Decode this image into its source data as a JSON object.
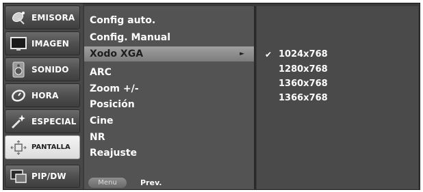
{
  "sidebar": {
    "items": [
      {
        "label": "EMISORA",
        "icon": "satellite-dish-icon"
      },
      {
        "label": "IMAGEN",
        "icon": "monitor-icon"
      },
      {
        "label": "SONIDO",
        "icon": "speaker-icon"
      },
      {
        "label": "HORA",
        "icon": "clock-icon"
      },
      {
        "label": "ESPECIAL",
        "icon": "wand-icon"
      },
      {
        "label": "PANTALLA",
        "icon": "screen-arrows-icon",
        "active": true
      },
      {
        "label": "PIP/DW",
        "icon": "picture-in-picture-icon"
      }
    ]
  },
  "menu": {
    "items": [
      {
        "label": "Config auto."
      },
      {
        "label": "Config. Manual"
      },
      {
        "label": "Xodo XGA",
        "selected": true,
        "arrow": "►"
      },
      {
        "label": "ARC"
      },
      {
        "label": "Zoom +/-"
      },
      {
        "label": "Posición"
      },
      {
        "label": "Cine"
      },
      {
        "label": "NR"
      },
      {
        "label": "Reajuste"
      }
    ]
  },
  "footer": {
    "menu_button": "Menu",
    "prev_label": "Prev."
  },
  "options": {
    "check_mark": "✔",
    "items": [
      {
        "label": "1024x768",
        "checked": true
      },
      {
        "label": "1280x768"
      },
      {
        "label": "1360x768"
      },
      {
        "label": "1366x768"
      }
    ]
  }
}
